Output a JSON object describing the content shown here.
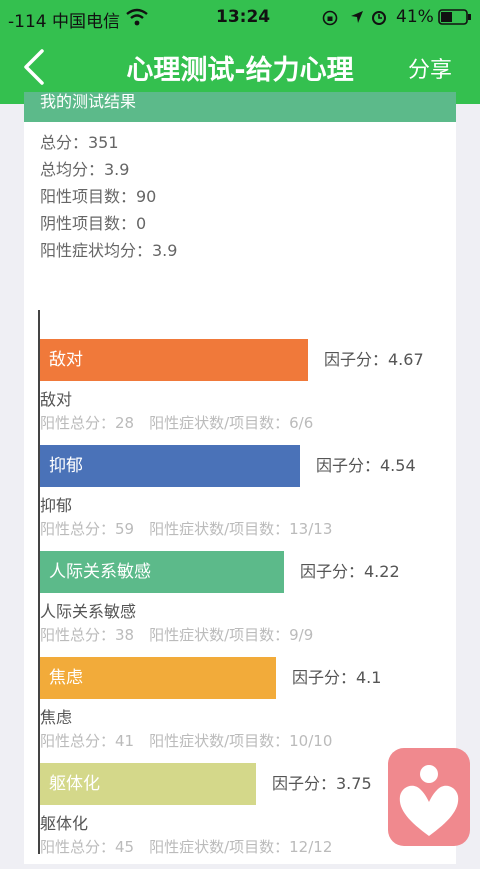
{
  "status": {
    "carrier": "-114 中国电信",
    "time": "13:24",
    "battery": "41%"
  },
  "nav": {
    "title": "心理测试-给力心理",
    "share": "分享"
  },
  "card": {
    "header": "我的测试结果"
  },
  "stats": {
    "total": "总分：351",
    "avg": "总均分：3.9",
    "positive_items": "阳性项目数：90",
    "negative_items": "阴性项目数：0",
    "positive_avg": "阳性症状均分：3.9"
  },
  "factors": [
    {
      "label": "敌对",
      "score_text": "因子分：4.67",
      "score": 4.67,
      "color": "#f0793a",
      "sub": "阳性总分：28　阳性症状数/项目数：6/6"
    },
    {
      "label": "抑郁",
      "score_text": "因子分：4.54",
      "score": 4.54,
      "color": "#4a72b8",
      "sub": "阳性总分：59　阳性症状数/项目数：13/13"
    },
    {
      "label": "人际关系敏感",
      "score_text": "因子分：4.22",
      "score": 4.22,
      "color": "#5cba8a",
      "sub": "阳性总分：38　阳性症状数/项目数：9/9"
    },
    {
      "label": "焦虑",
      "score_text": "因子分：4.1",
      "score": 4.1,
      "color": "#f2ab3a",
      "sub": "阳性总分：41　阳性症状数/项目数：10/10"
    },
    {
      "label": "躯体化",
      "score_text": "因子分：3.75",
      "score": 3.75,
      "color": "#d4d88a",
      "sub": "阳性总分：45　阳性症状数/项目数：12/12"
    }
  ],
  "colors": {
    "nav": "#34c04f",
    "badge": "#f0898e"
  }
}
